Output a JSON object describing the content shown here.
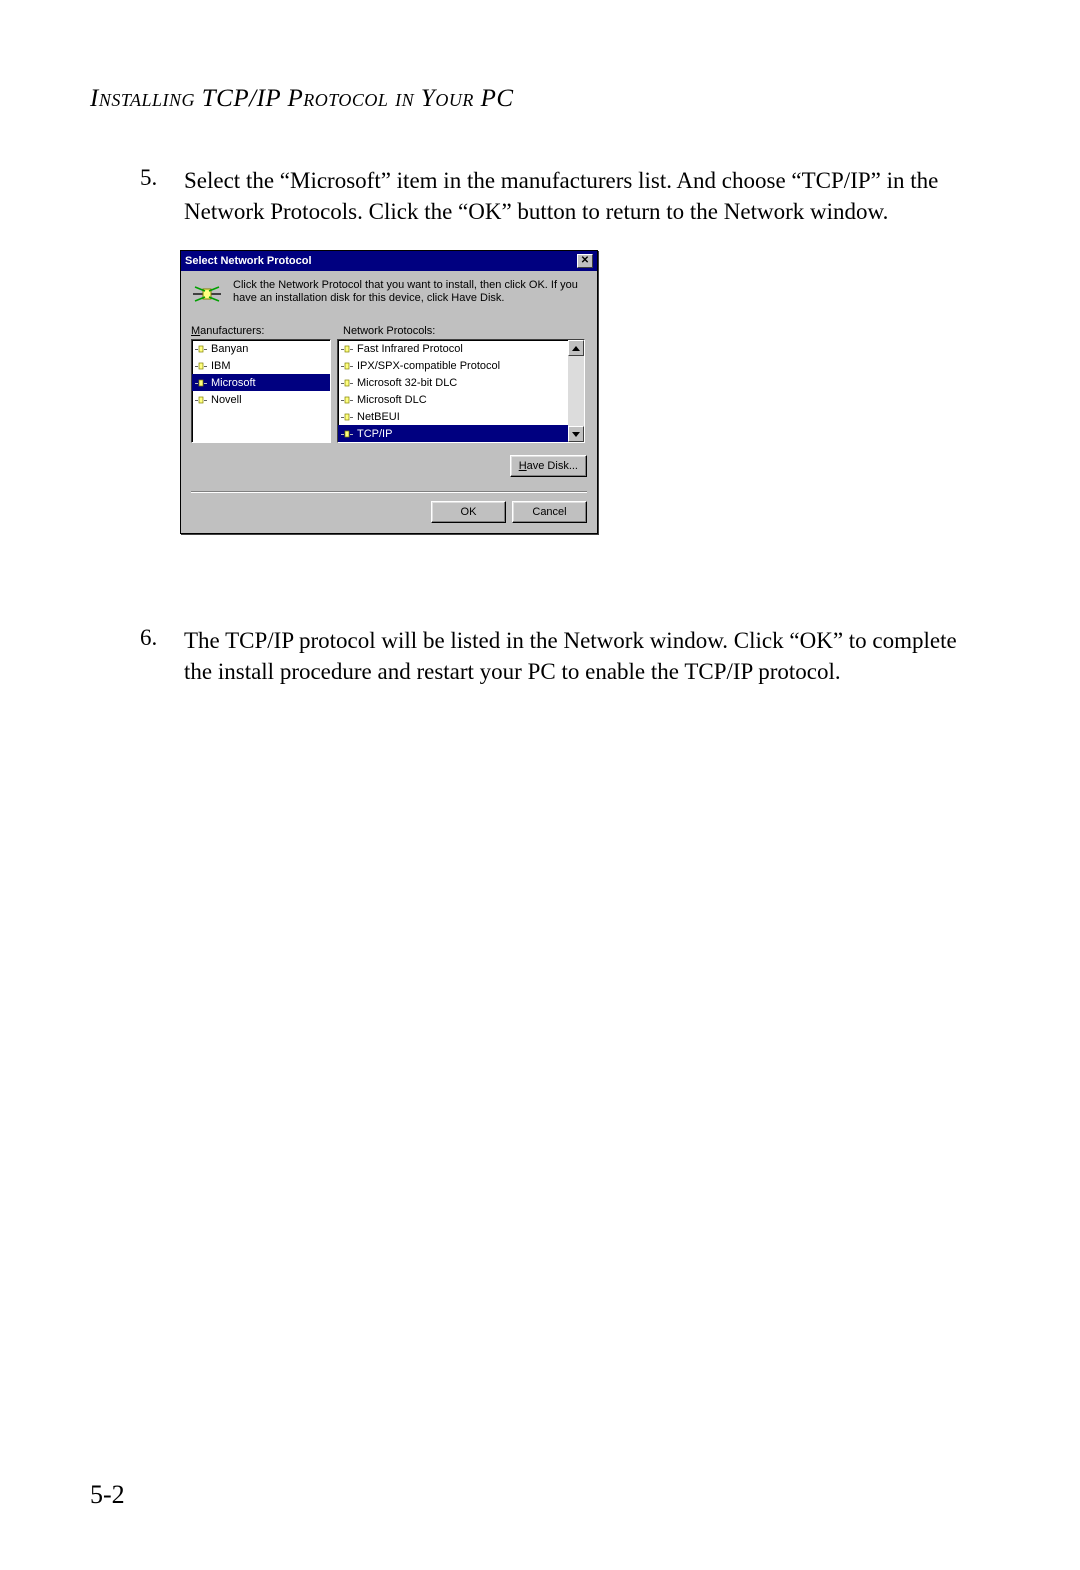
{
  "page": {
    "heading": "Installing TCP/IP Protocol in Your PC",
    "pageNumber": "5-2"
  },
  "steps": {
    "step5": {
      "num": "5.",
      "text": "Select the “Microsoft” item in the manufacturers list. And choose “TCP/IP” in the Network Protocols. Click the “OK” button to return to the Network window."
    },
    "step6": {
      "num": "6.",
      "text": "The TCP/IP protocol will be listed in the Network window. Click “OK” to complete the install procedure and restart your PC to enable the TCP/IP protocol."
    }
  },
  "dialog": {
    "title": "Select Network Protocol",
    "infoText": "Click the Network Protocol that you want to install, then click OK. If you have an installation disk for this device, click Have Disk.",
    "manufacturersLabel": "anufacturers:",
    "manufacturersMnemonic": "M",
    "protocolsLabel": "Network Protocols:",
    "manufacturers": {
      "i0": "Banyan",
      "i1": "IBM",
      "i2": "Microsoft",
      "i3": "Novell"
    },
    "protocols": {
      "i0": "Fast Infrared Protocol",
      "i1": "IPX/SPX-compatible Protocol",
      "i2": "Microsoft 32-bit DLC",
      "i3": "Microsoft DLC",
      "i4": "NetBEUI",
      "i5": "TCP/IP"
    },
    "haveDiskMnemonic": "H",
    "haveDiskRest": "ave Disk...",
    "okLabel": "OK",
    "cancelLabel": "Cancel"
  }
}
